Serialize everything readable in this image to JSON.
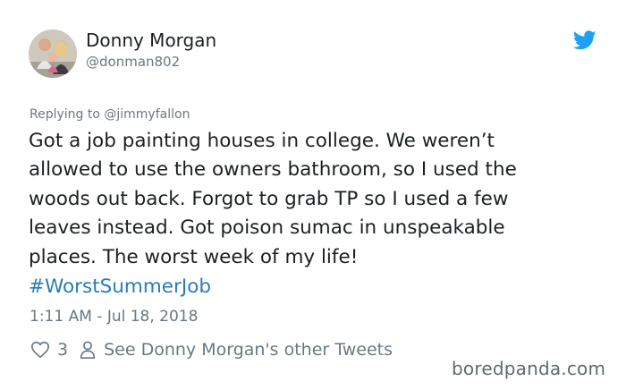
{
  "author": {
    "name": "Donny Morgan",
    "handle": "@donman802"
  },
  "icons": {
    "brand": "twitter-bird-icon",
    "like": "heart-icon",
    "profile": "person-icon",
    "brand_color": "#1da1f2"
  },
  "tweet": {
    "reply_to": "Replying to @jimmyfallon",
    "text": "Got a job painting houses in college. We weren’t\nallowed to use the owners bathroom, so I used the\nwoods out back. Forgot to grab TP so I used a few\nleaves instead. Got poison sumac in unspeakable\nplaces. The worst week of my life!",
    "hashtag": "#WorstSummerJob",
    "timestamp": "1:11 AM - Jul 18, 2018"
  },
  "actions": {
    "like_count": "3",
    "other_tweets_label": "See Donny Morgan's other Tweets"
  },
  "watermark": "boredpanda.com"
}
